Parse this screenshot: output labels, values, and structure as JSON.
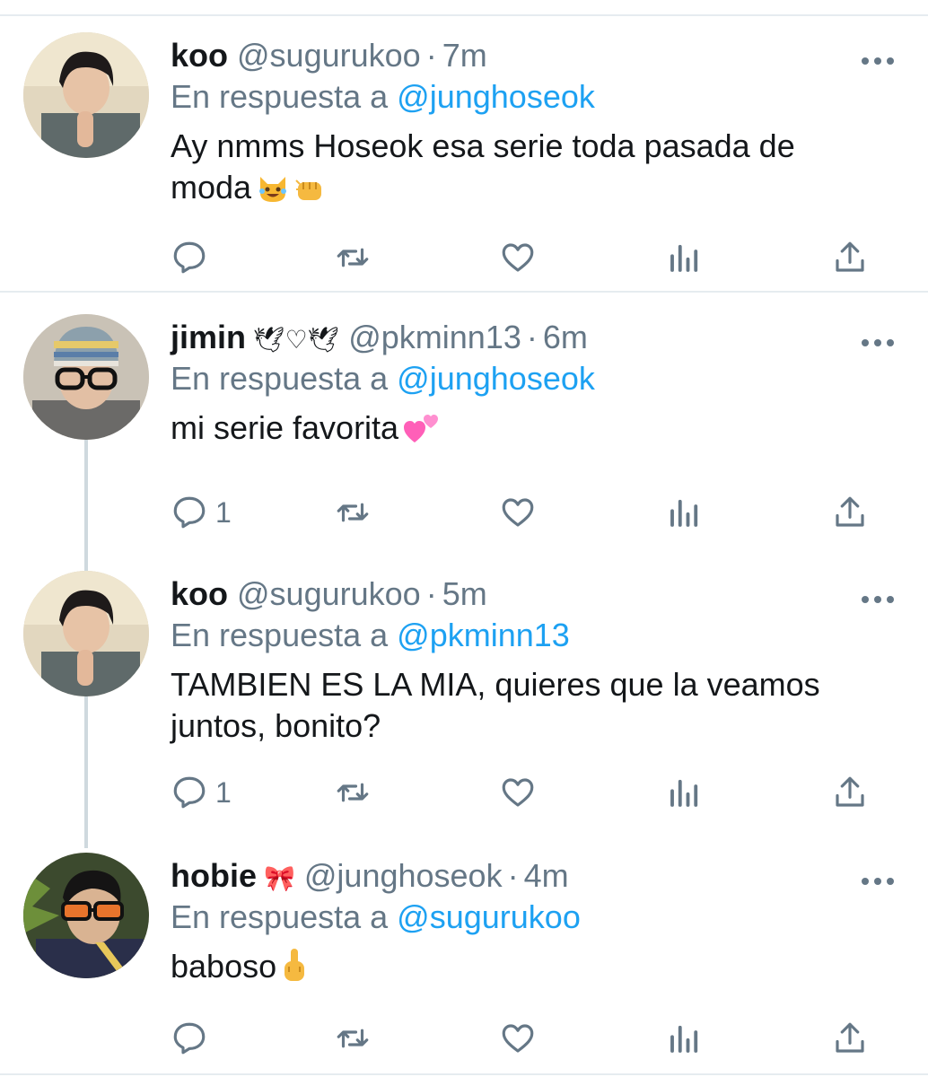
{
  "tweets": [
    {
      "name": "koo",
      "deco": "",
      "handle": "@sugurukoo",
      "time": "7m",
      "reply_prefix": "En respuesta a",
      "reply_to": "@junghoseok",
      "text": "Ay nmms Hoseok esa serie toda pasada de moda",
      "emojis": [
        "laughing-cat-emoji",
        "fist-bump-emoji"
      ],
      "reply_count": "",
      "avatar": "koo-avatar"
    },
    {
      "name": "jimin",
      "deco": "🕊♡🕊",
      "handle": "@pkminn13",
      "time": "6m",
      "reply_prefix": "En respuesta a",
      "reply_to": "@junghoseok",
      "text": "mi serie favorita",
      "emojis": [
        "two-hearts-emoji"
      ],
      "reply_count": "1",
      "avatar": "jimin-avatar"
    },
    {
      "name": "koo",
      "deco": "",
      "handle": "@sugurukoo",
      "time": "5m",
      "reply_prefix": "En respuesta a",
      "reply_to": "@pkminn13",
      "text": "TAMBIEN ES LA MIA, quieres que la veamos juntos, bonito?",
      "emojis": [],
      "reply_count": "1",
      "avatar": "koo-avatar"
    },
    {
      "name": "hobie",
      "deco": "🎀",
      "handle": "@junghoseok",
      "time": "4m",
      "reply_prefix": "En respuesta a",
      "reply_to": "@sugurukoo",
      "text": "baboso",
      "emojis": [
        "middle-finger-emoji"
      ],
      "reply_count": "",
      "avatar": "hobie-avatar"
    }
  ],
  "icons": {
    "reply": "comment-icon",
    "retweet": "retweet-icon",
    "like": "heart-icon",
    "stats": "analytics-icon",
    "share": "share-icon",
    "more": "more-options-icon"
  },
  "colors": {
    "text": "#14171a",
    "secondary": "#657786",
    "link": "#1da1f2",
    "divider": "#e6ecf0",
    "thread": "#cfd9de"
  }
}
